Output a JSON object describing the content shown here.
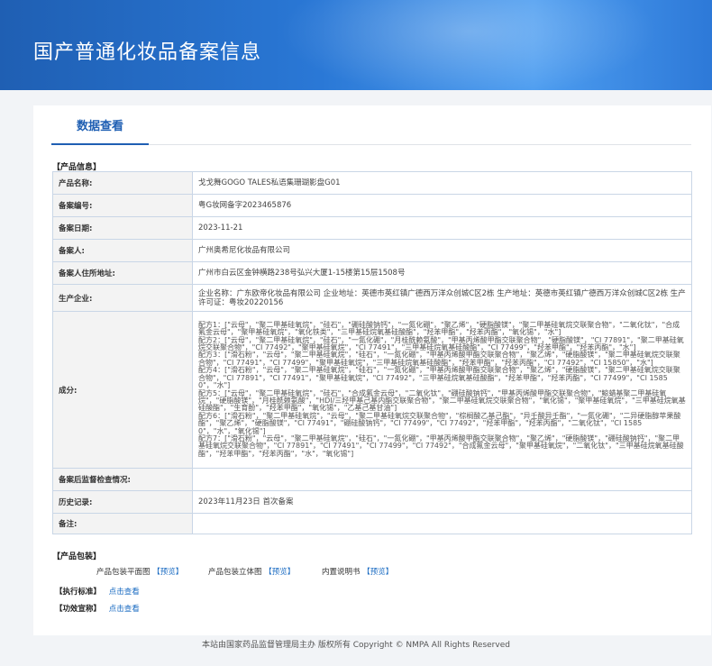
{
  "page_title": "国产普通化妆品备案信息",
  "tab_label": "数据查看",
  "section_product_info": "【产品信息】",
  "rows": [
    {
      "label": "产品名称:",
      "value": "戈戈舞GOGO TALES私语集珊瑚影盘G01"
    },
    {
      "label": "备案编号:",
      "value": "粤G妆网备字2023465876"
    },
    {
      "label": "备案日期:",
      "value": "2023-11-21"
    },
    {
      "label": "备案人:",
      "value": "广州奥希尼化妆品有限公司"
    },
    {
      "label": "备案人住所地址:",
      "value": "广州市白云区金钟横路238号弘兴大厦1-15楼第15层1508号"
    },
    {
      "label": "生产企业:",
      "value": "企业名称：广东欧帝化妆品有限公司 企业地址：英德市英红镇广德西万洋众创城C区2栋 生产地址：英德市英红镇广德西万洋众创城C区2栋 生产许可证：粤妆20220156"
    },
    {
      "label": "成分:",
      "value": [
        "配方1：[\"云母\"，\"聚二甲基硅氧烷\"，\"硅石\"，\"硼硅酸钠钙\"，\"一氮化硼\"，\"聚乙烯\"，\"硬脂酸镁\"，\"聚二甲基硅氧烷交联聚合物\"，\"二氧化钛\"，\"合成氟金云母\"，\"聚甲基硅氧烷\"，\"氧化铁类\"，\"三甲基硅烷氧基硅酸酯\"，\"羟苯甲酯\"，\"羟苯丙酯\"，\"氧化锡\"，\"水\"]",
        "配方2：[\"云母\"，\"聚二甲基硅氧烷\"，\"硅石\"，\"一氮化硼\"，\"月桂酰赖氨酸\"，\"甲基丙烯酸甲酯交联聚合物\"，\"硬脂酸镁\"，\"CI 77891\"，\"聚二甲基硅氧烷交联聚合物\"，\"CI 77492\"，\"聚甲基硅氧烷\"，\"CI 77491\"，\"三甲基硅烷氧基硅酸酯\"，\"CI 77499\"，\"羟苯甲酯\"，\"羟苯丙酯\"，\"水\"]",
        "配方3：[\"滑石粉\"，\"云母\"，\"聚二甲基硅氧烷\"，\"硅石\"，\"一氮化硼\"，\"甲基丙烯酸甲酯交联聚合物\"，\"聚乙烯\"，\"硬脂酸镁\"，\"聚二甲基硅氧烷交联聚合物\"，\"CI 77491\"，\"CI 77499\"，\"聚甲基硅氧烷\"，\"三甲基硅烷氧基硅酸酯\"，\"羟苯甲酯\"，\"羟苯丙酯\"，\"CI 77492\"，\"CI 15850\"，\"水\"]",
        "配方4：[\"滑石粉\"，\"云母\"，\"聚二甲基硅氧烷\"，\"硅石\"，\"一氮化硼\"，\"甲基丙烯酸甲酯交联聚合物\"，\"聚乙烯\"，\"硬脂酸镁\"，\"聚二甲基硅氧烷交联聚合物\"，\"CI 77891\"，\"CI 77491\"，\"聚甲基硅氧烷\"，\"CI 77492\"，\"三甲基硅烷氧基硅酸酯\"，\"羟苯甲酯\"，\"羟苯丙酯\"，\"CI 77499\"，\"CI 15850\"，\"水\"]",
        "配方5：[\"云母\"，\"聚二甲基硅氧烷\"，\"硅石\"，\"合成氟金云母\"，\"二氧化钛\"，\"硼硅酸钠钙\"，\"甲基丙烯酸甲酯交联聚合物\"，\"鲸蜡基聚二甲基硅氧烷\"，\"硬脂酸镁\"，\"月桂酰赖氨酸\"，\"HDI/三羟甲基己基内酯交联聚合物\"，\"聚二甲基硅氧烷交联聚合物\"，\"氧化锡\"，\"聚甲基硅氧烷\"，\"三甲基硅烷氧基硅酸酯\"，\"生育酚\"，\"羟苯甲酯\"，\"氧化锡\"，\"乙基己基甘油\"]",
        "配方6：[\"滑石粉\"，\"聚二甲基硅氧烷\"，\"云母\"，\"聚二甲基硅氧烷交联聚合物\"，\"棕榈酸乙基己酯\"，\"异壬酸异壬酯\"，\"一氮化硼\"，\"二异硬脂醇苹果酸酯\"，\"聚乙烯\"，\"硬脂酸镁\"，\"CI 77491\"，\"硼硅酸钠钙\"，\"CI 77499\"，\"CI 77492\"，\"羟苯甲酯\"，\"羟苯丙酯\"，\"二氧化钛\"，\"CI 15850\"，\"水\"，\"氧化锡\"]",
        "配方7：[\"滑石粉\"，\"云母\"，\"聚二甲基硅氧烷\"，\"硅石\"，\"一氮化硼\"，\"甲基丙烯酸甲酯交联聚合物\"，\"聚乙烯\"，\"硬脂酸镁\"，\"硼硅酸钠钙\"，\"聚二甲基硅氧烷交联聚合物\"，\"CI 77891\"，\"CI 77491\"，\"CI 77499\"，\"CI 77492\"，\"合成氟金云母\"，\"聚甲基硅氧烷\"，\"二氧化钛\"，\"三甲基硅烷氧基硅酸酯\"，\"羟苯甲酯\"，\"羟苯丙酯\"，\"水\"，\"氧化锡\"]"
      ]
    },
    {
      "label": "备案后监督检查情况:",
      "value": ""
    },
    {
      "label": "历史记录:",
      "value": "2023年11月23日 首次备案"
    },
    {
      "label": "备注:",
      "value": ""
    }
  ],
  "section_packaging": "【产品包装】",
  "packaging": [
    {
      "label": "产品包装平面图",
      "link": "【预览】"
    },
    {
      "label": "产品包装立体图",
      "link": "【预览】"
    },
    {
      "label": "内置说明书",
      "link": "【预览】"
    }
  ],
  "standard": {
    "label": "【执行标准】",
    "link": "点击查看"
  },
  "efficacy": {
    "label": "【功效宣称】",
    "link": "点击查看"
  },
  "footer": "本站由国家药品监督管理局主办 版权所有 Copyright © NMPA All Rights Reserved"
}
